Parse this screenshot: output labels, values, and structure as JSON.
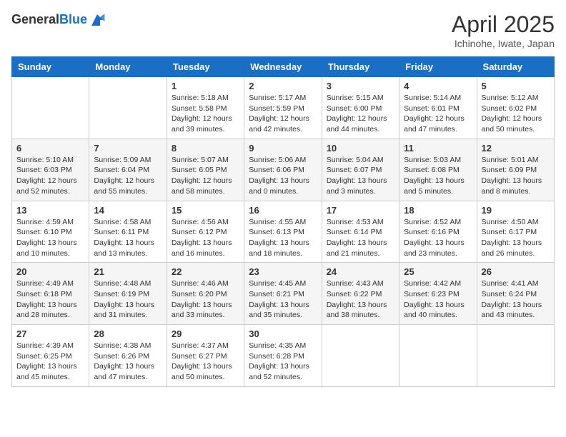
{
  "logo": {
    "general": "General",
    "blue": "Blue"
  },
  "title": "April 2025",
  "subtitle": "Ichinohe, Iwate, Japan",
  "days_of_week": [
    "Sunday",
    "Monday",
    "Tuesday",
    "Wednesday",
    "Thursday",
    "Friday",
    "Saturday"
  ],
  "weeks": [
    [
      null,
      null,
      {
        "day": 1,
        "sunrise": "5:18 AM",
        "sunset": "5:58 PM",
        "daylight": "12 hours and 39 minutes."
      },
      {
        "day": 2,
        "sunrise": "5:17 AM",
        "sunset": "5:59 PM",
        "daylight": "12 hours and 42 minutes."
      },
      {
        "day": 3,
        "sunrise": "5:15 AM",
        "sunset": "6:00 PM",
        "daylight": "12 hours and 44 minutes."
      },
      {
        "day": 4,
        "sunrise": "5:14 AM",
        "sunset": "6:01 PM",
        "daylight": "12 hours and 47 minutes."
      },
      {
        "day": 5,
        "sunrise": "5:12 AM",
        "sunset": "6:02 PM",
        "daylight": "12 hours and 50 minutes."
      }
    ],
    [
      {
        "day": 6,
        "sunrise": "5:10 AM",
        "sunset": "6:03 PM",
        "daylight": "12 hours and 52 minutes."
      },
      {
        "day": 7,
        "sunrise": "5:09 AM",
        "sunset": "6:04 PM",
        "daylight": "12 hours and 55 minutes."
      },
      {
        "day": 8,
        "sunrise": "5:07 AM",
        "sunset": "6:05 PM",
        "daylight": "12 hours and 58 minutes."
      },
      {
        "day": 9,
        "sunrise": "5:06 AM",
        "sunset": "6:06 PM",
        "daylight": "13 hours and 0 minutes."
      },
      {
        "day": 10,
        "sunrise": "5:04 AM",
        "sunset": "6:07 PM",
        "daylight": "13 hours and 3 minutes."
      },
      {
        "day": 11,
        "sunrise": "5:03 AM",
        "sunset": "6:08 PM",
        "daylight": "13 hours and 5 minutes."
      },
      {
        "day": 12,
        "sunrise": "5:01 AM",
        "sunset": "6:09 PM",
        "daylight": "13 hours and 8 minutes."
      }
    ],
    [
      {
        "day": 13,
        "sunrise": "4:59 AM",
        "sunset": "6:10 PM",
        "daylight": "13 hours and 10 minutes."
      },
      {
        "day": 14,
        "sunrise": "4:58 AM",
        "sunset": "6:11 PM",
        "daylight": "13 hours and 13 minutes."
      },
      {
        "day": 15,
        "sunrise": "4:56 AM",
        "sunset": "6:12 PM",
        "daylight": "13 hours and 16 minutes."
      },
      {
        "day": 16,
        "sunrise": "4:55 AM",
        "sunset": "6:13 PM",
        "daylight": "13 hours and 18 minutes."
      },
      {
        "day": 17,
        "sunrise": "4:53 AM",
        "sunset": "6:14 PM",
        "daylight": "13 hours and 21 minutes."
      },
      {
        "day": 18,
        "sunrise": "4:52 AM",
        "sunset": "6:16 PM",
        "daylight": "13 hours and 23 minutes."
      },
      {
        "day": 19,
        "sunrise": "4:50 AM",
        "sunset": "6:17 PM",
        "daylight": "13 hours and 26 minutes."
      }
    ],
    [
      {
        "day": 20,
        "sunrise": "4:49 AM",
        "sunset": "6:18 PM",
        "daylight": "13 hours and 28 minutes."
      },
      {
        "day": 21,
        "sunrise": "4:48 AM",
        "sunset": "6:19 PM",
        "daylight": "13 hours and 31 minutes."
      },
      {
        "day": 22,
        "sunrise": "4:46 AM",
        "sunset": "6:20 PM",
        "daylight": "13 hours and 33 minutes."
      },
      {
        "day": 23,
        "sunrise": "4:45 AM",
        "sunset": "6:21 PM",
        "daylight": "13 hours and 35 minutes."
      },
      {
        "day": 24,
        "sunrise": "4:43 AM",
        "sunset": "6:22 PM",
        "daylight": "13 hours and 38 minutes."
      },
      {
        "day": 25,
        "sunrise": "4:42 AM",
        "sunset": "6:23 PM",
        "daylight": "13 hours and 40 minutes."
      },
      {
        "day": 26,
        "sunrise": "4:41 AM",
        "sunset": "6:24 PM",
        "daylight": "13 hours and 43 minutes."
      }
    ],
    [
      {
        "day": 27,
        "sunrise": "4:39 AM",
        "sunset": "6:25 PM",
        "daylight": "13 hours and 45 minutes."
      },
      {
        "day": 28,
        "sunrise": "4:38 AM",
        "sunset": "6:26 PM",
        "daylight": "13 hours and 47 minutes."
      },
      {
        "day": 29,
        "sunrise": "4:37 AM",
        "sunset": "6:27 PM",
        "daylight": "13 hours and 50 minutes."
      },
      {
        "day": 30,
        "sunrise": "4:35 AM",
        "sunset": "6:28 PM",
        "daylight": "13 hours and 52 minutes."
      },
      null,
      null,
      null
    ]
  ],
  "labels": {
    "sunrise": "Sunrise:",
    "sunset": "Sunset:",
    "daylight": "Daylight:"
  }
}
